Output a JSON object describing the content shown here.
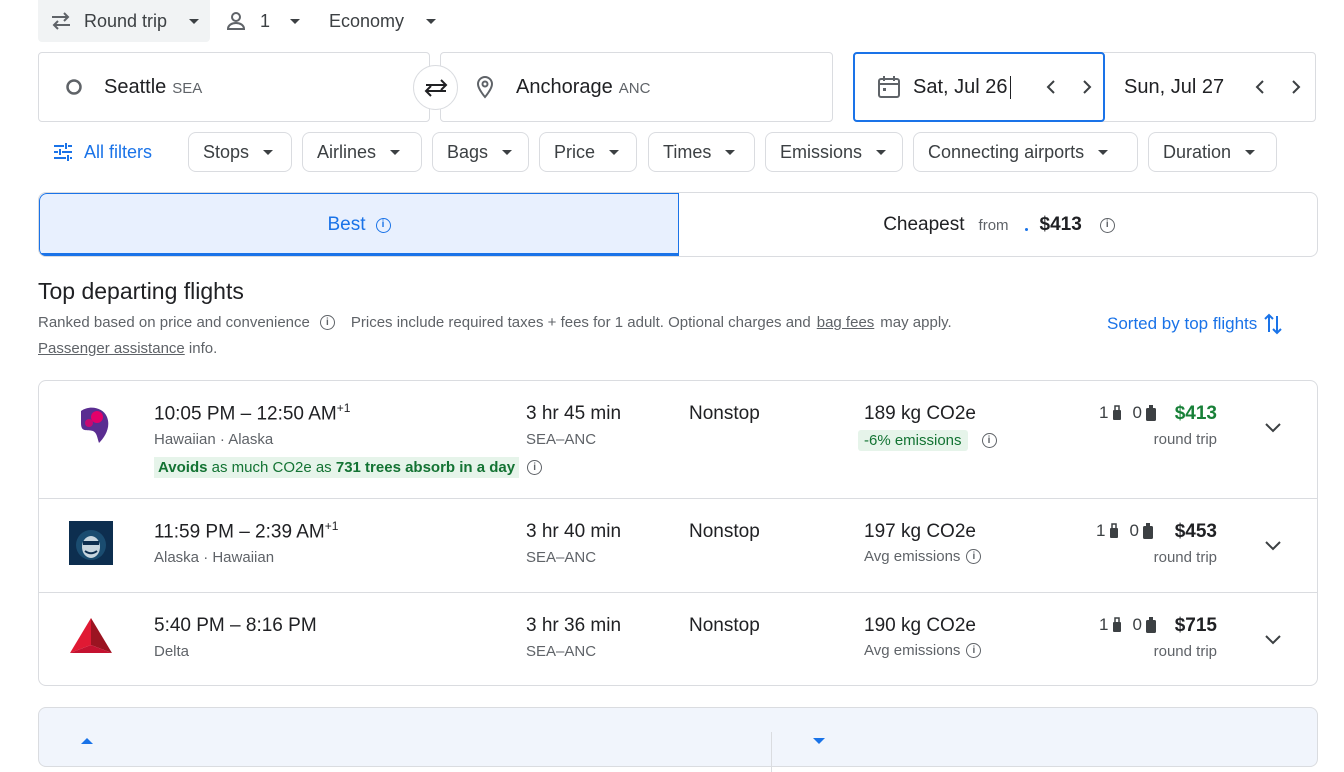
{
  "search": {
    "trip_type": "Round trip",
    "passengers": "1",
    "cabin": "Economy",
    "origin_city": "Seattle",
    "origin_code": "SEA",
    "destination_city": "Anchorage",
    "destination_code": "ANC",
    "depart_date": "Sat, Jul 26",
    "return_date": "Sun, Jul 27"
  },
  "filters": {
    "all_filters": "All filters",
    "chips": [
      "Stops",
      "Airlines",
      "Bags",
      "Price",
      "Times",
      "Emissions",
      "Connecting airports",
      "Duration"
    ]
  },
  "tabs": {
    "best": "Best",
    "cheapest": "Cheapest",
    "from": "from",
    "cheapest_price": "$413"
  },
  "results_header": {
    "title": "Top departing flights",
    "ranked": "Ranked based on price and convenience",
    "prices_note_a": "Prices include required taxes + fees for 1 adult. Optional charges and",
    "bag_fees": "bag fees",
    "prices_note_b": "may apply.",
    "passenger_assistance": "Passenger assistance",
    "info": "info.",
    "sorted": "Sorted by top flights"
  },
  "flights": [
    {
      "time": "10:05 PM – 12:50 AM",
      "plus": "+1",
      "airline": "Hawaiian · Alaska",
      "duration": "3 hr 45 min",
      "route": "SEA–ANC",
      "stops": "Nonstop",
      "co2": "189 kg CO2e",
      "emissions": "-6% emissions",
      "carry_on": "1",
      "checked": "0",
      "price": "$413",
      "price_color": "#188038",
      "price_note": "round trip",
      "avoid_a": "Avoids",
      "avoid_b": "as much CO2e as",
      "avoid_c": "731 trees absorb in a day"
    },
    {
      "time": "11:59 PM – 2:39 AM",
      "plus": "+1",
      "airline": "Alaska · Hawaiian",
      "duration": "3 hr 40 min",
      "route": "SEA–ANC",
      "stops": "Nonstop",
      "co2": "197 kg CO2e",
      "emissions": "Avg emissions",
      "carry_on": "1",
      "checked": "0",
      "price": "$453",
      "price_color": "#202124",
      "price_note": "round trip"
    },
    {
      "time": "5:40 PM – 8:16 PM",
      "airline": "Delta",
      "duration": "3 hr 36 min",
      "route": "SEA–ANC",
      "stops": "Nonstop",
      "co2": "190 kg CO2e",
      "emissions": "Avg emissions",
      "carry_on": "1",
      "checked": "0",
      "price": "$715",
      "price_color": "#202124",
      "price_note": "round trip"
    }
  ],
  "colors": {
    "accent": "#1a73e8",
    "green": "#188038"
  }
}
